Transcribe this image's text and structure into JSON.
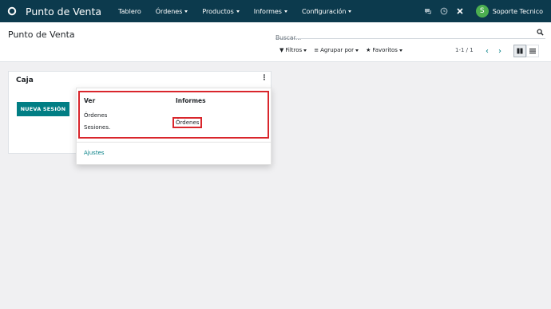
{
  "navbar": {
    "app_title": "Punto de Venta",
    "menu": [
      {
        "label": "Tablero",
        "has_caret": false
      },
      {
        "label": "Órdenes",
        "has_caret": true
      },
      {
        "label": "Productos",
        "has_caret": true
      },
      {
        "label": "Informes",
        "has_caret": true
      },
      {
        "label": "Configuración",
        "has_caret": true
      }
    ],
    "user": {
      "initial": "S",
      "name": "Soporte Tecnico"
    }
  },
  "control_panel": {
    "breadcrumb": "Punto de Venta",
    "search_placeholder": "Buscar...",
    "filters_label": "Filtros",
    "group_by_label": "Agrupar por",
    "favorites_label": "Favoritos",
    "pager_value": "1-1 / 1"
  },
  "card": {
    "title": "Caja",
    "menu_glyph": "⋮",
    "new_session_label": "NUEVA SESIÓN"
  },
  "dropdown": {
    "view_header": "Ver",
    "view_items": [
      "Órdenes",
      "Sesiones."
    ],
    "reports_header": "Informes",
    "reports_items": [
      "Órdenes"
    ],
    "settings_label": "Ajustes"
  },
  "colors": {
    "navbar_bg": "#0c3a4d",
    "accent": "#017e84",
    "highlight_red": "#d9262c",
    "avatar_green": "#4caf50"
  }
}
